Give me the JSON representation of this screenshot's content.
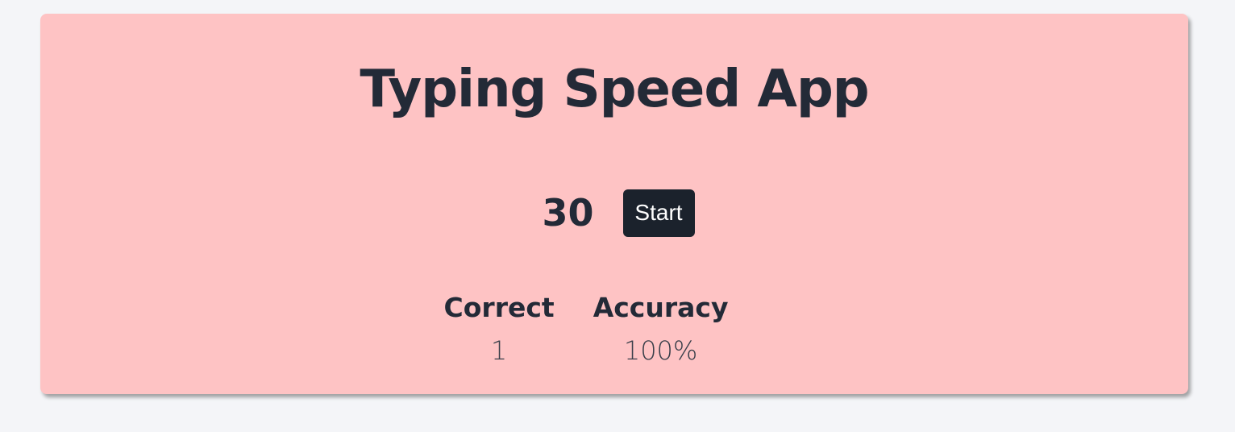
{
  "app": {
    "title": "Typing Speed App"
  },
  "controls": {
    "timer": "30",
    "start_label": "Start"
  },
  "stats": {
    "correct_label": "Correct",
    "correct_value": "1",
    "accuracy_label": "Accuracy",
    "accuracy_value": "100%"
  },
  "colors": {
    "card_background": "#fec3c4",
    "page_background": "#f4f5f8",
    "text": "#232a37",
    "button_background": "#1b222c"
  }
}
